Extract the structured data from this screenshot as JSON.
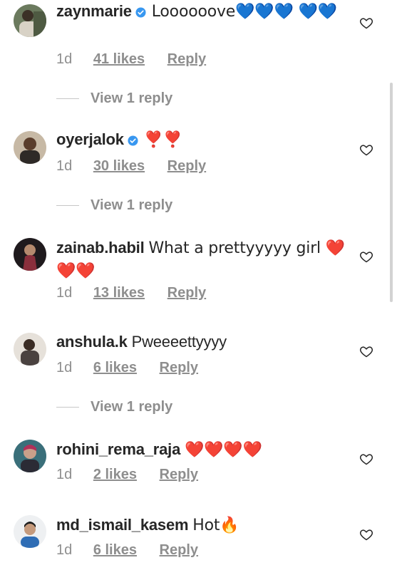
{
  "comments": [
    {
      "username": "zaynmarie",
      "text": "Loooooove💙💙💙 💙💙",
      "time": "1d",
      "likes": "41 likes",
      "reply": "Reply",
      "view_replies": "View 1 reply",
      "verified": true
    },
    {
      "username": "oyerjalok",
      "text": "❣️❣️",
      "time": "1d",
      "likes": "30 likes",
      "reply": "Reply",
      "view_replies": "View 1 reply",
      "verified": true
    },
    {
      "username": "zainab.habil",
      "text": "What a prettyyyyy girl ❤️❤️❤️",
      "time": "1d",
      "likes": "13 likes",
      "reply": "Reply",
      "verified": false
    },
    {
      "username": "anshula.k",
      "text": "Pweeeettyyyy",
      "time": "1d",
      "likes": "6 likes",
      "reply": "Reply",
      "view_replies": "View 1 reply",
      "verified": false
    },
    {
      "username": "rohini_rema_raja",
      "text": "❤️❤️❤️❤️",
      "time": "1d",
      "likes": "2 likes",
      "reply": "Reply",
      "verified": false
    },
    {
      "username": "md_ismail_kasem",
      "text": "Hot🔥",
      "time": "1d",
      "likes": "6 likes",
      "reply": "Reply",
      "verified": false
    }
  ],
  "icons": {
    "like": "heart-outline-icon",
    "verified": "verified-badge-icon"
  },
  "colors": {
    "verified_blue": "#3897f0",
    "muted_text": "#8e8e8e",
    "primary_text": "#262626"
  }
}
